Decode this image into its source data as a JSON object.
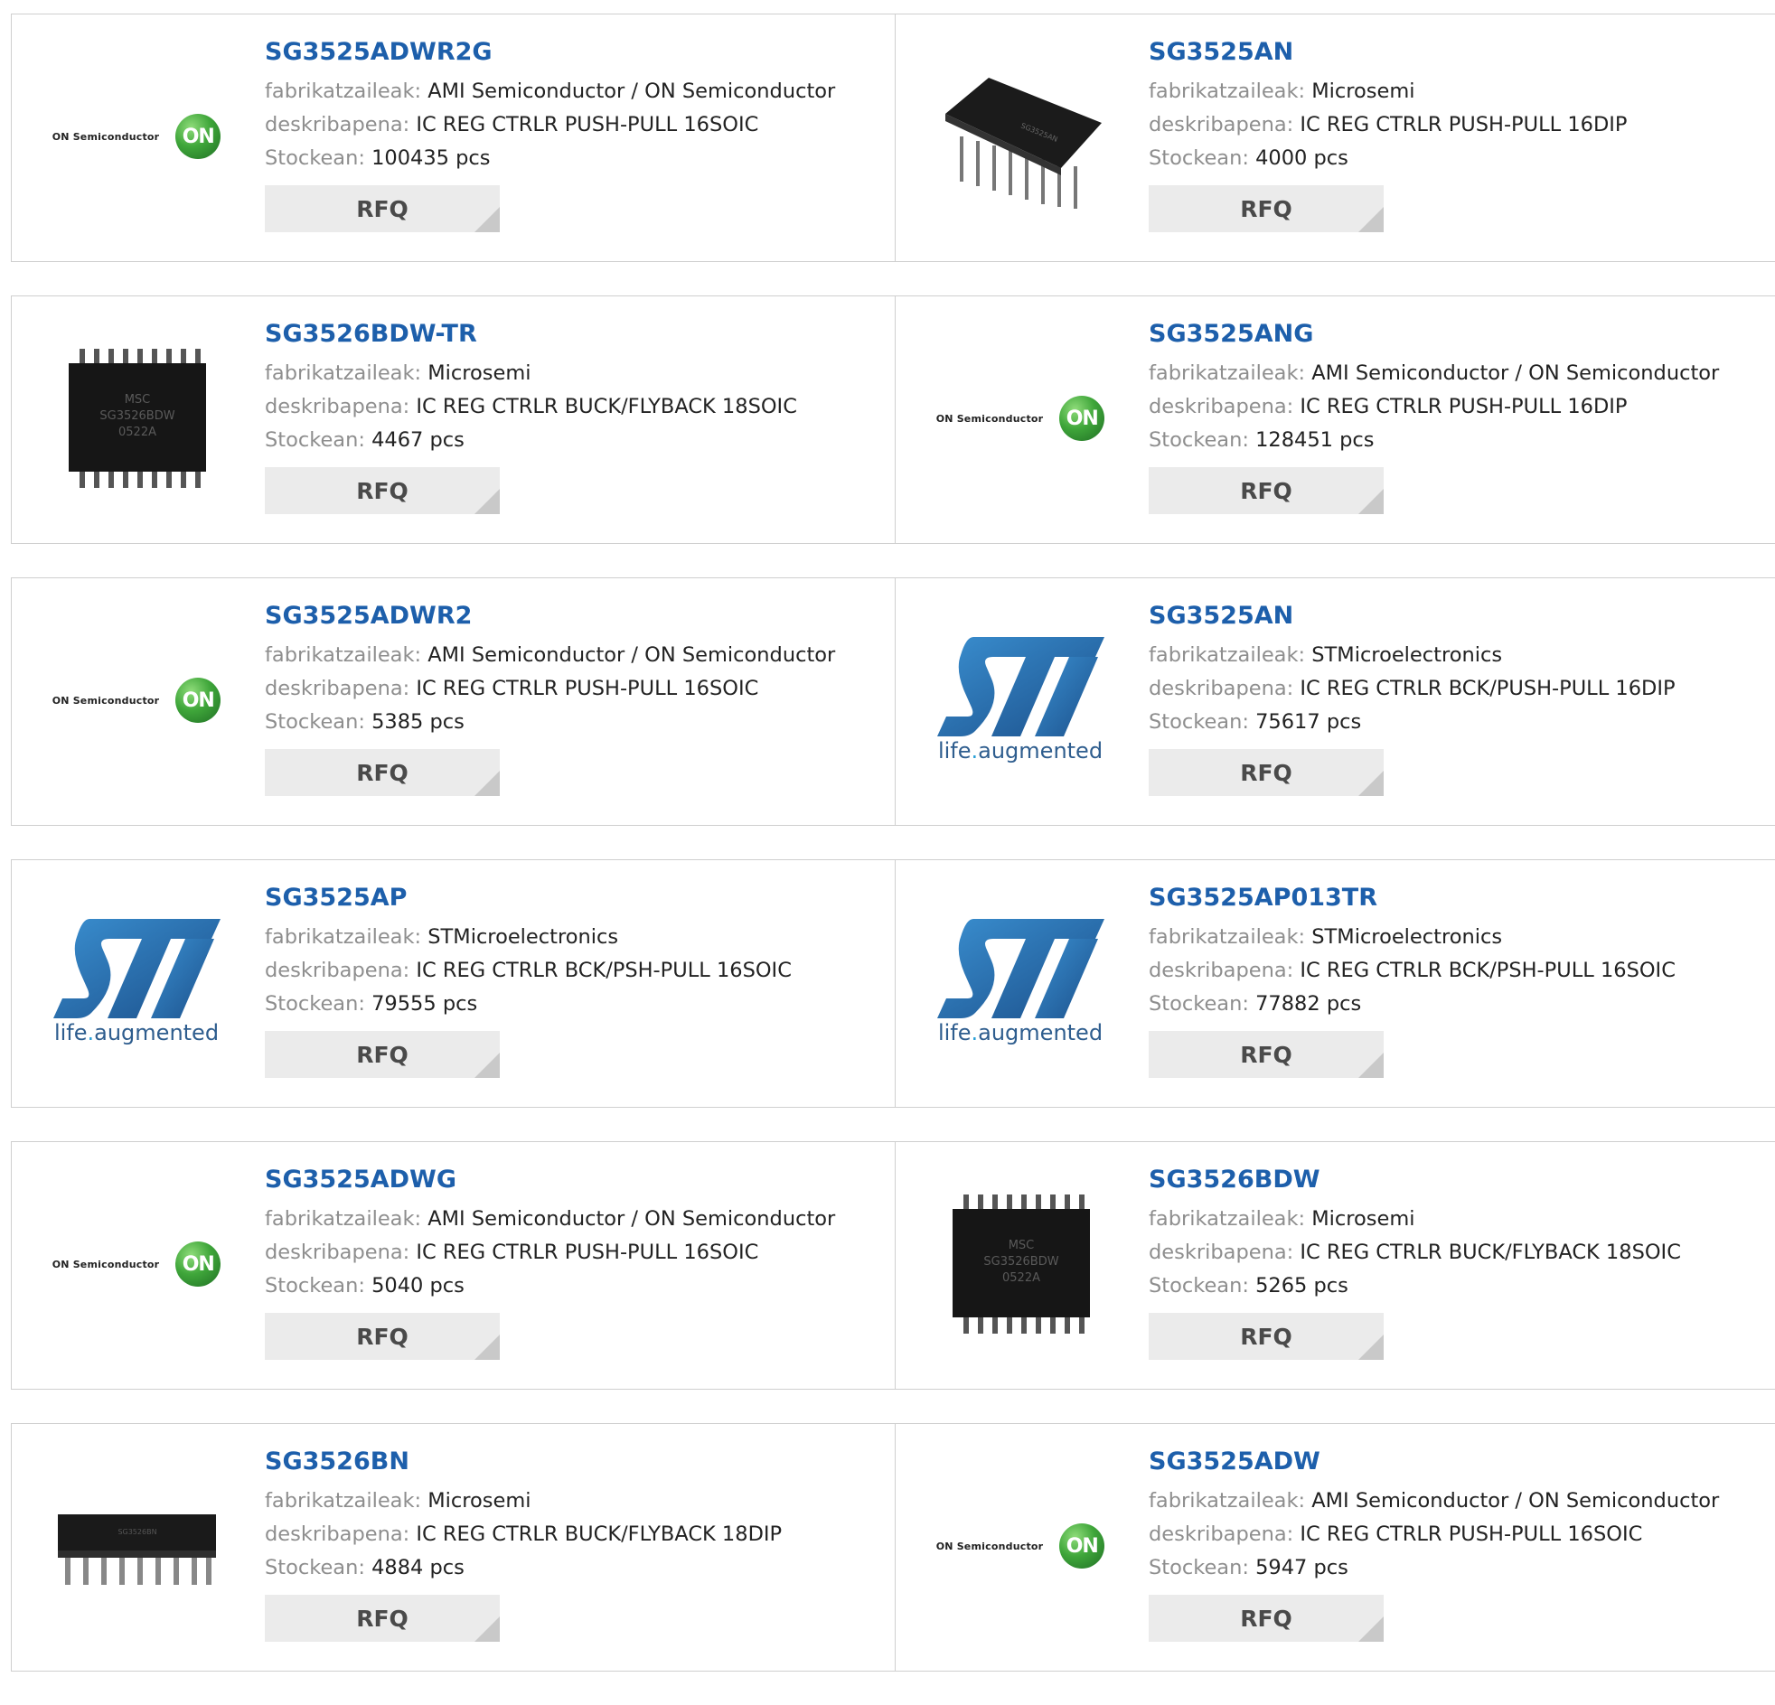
{
  "labels": {
    "manufacturer": "fabrikatzaileak:",
    "description": "deskribapena:",
    "stock": "Stockean:",
    "rfq": "RFQ"
  },
  "logos": {
    "on_text": "ON Semiconductor",
    "on_disc": "ON",
    "st_tag_a": "life",
    "st_tag_dot": ".",
    "st_tag_b": "augmented",
    "chip_msc": "MSC",
    "chip_3526": "SG3526BDW",
    "chip_code": "0522A"
  },
  "colors": {
    "part_link": "#1d5fab",
    "label_gray": "#8e8e8e",
    "button_bg": "#ebebeb",
    "on_green": "#3fa63a",
    "st_blue": "#2e6fb0"
  },
  "products": [
    {
      "part": "SG3525ADWR2G",
      "manufacturer": "AMI Semiconductor / ON Semiconductor",
      "description": "IC REG CTRLR PUSH-PULL 16SOIC",
      "stock": "100435 pcs",
      "image": "on-semiconductor-logo"
    },
    {
      "part": "SG3525AN",
      "manufacturer": "Microsemi",
      "description": "IC REG CTRLR PUSH-PULL 16DIP",
      "stock": "4000 pcs",
      "image": "dip16-chip"
    },
    {
      "part": "SG3526BDW-TR",
      "manufacturer": "Microsemi",
      "description": "IC REG CTRLR BUCK/FLYBACK 18SOIC",
      "stock": "4467 pcs",
      "image": "soic18-chip"
    },
    {
      "part": "SG3525ANG",
      "manufacturer": "AMI Semiconductor / ON Semiconductor",
      "description": "IC REG CTRLR PUSH-PULL 16DIP",
      "stock": "128451 pcs",
      "image": "on-semiconductor-logo"
    },
    {
      "part": "SG3525ADWR2",
      "manufacturer": "AMI Semiconductor / ON Semiconductor",
      "description": "IC REG CTRLR PUSH-PULL 16SOIC",
      "stock": "5385 pcs",
      "image": "on-semiconductor-logo"
    },
    {
      "part": "SG3525AN",
      "manufacturer": "STMicroelectronics",
      "description": "IC REG CTRLR BCK/PUSH-PULL 16DIP",
      "stock": "75617 pcs",
      "image": "st-logo"
    },
    {
      "part": "SG3525AP",
      "manufacturer": "STMicroelectronics",
      "description": "IC REG CTRLR BCK/PSH-PULL 16SOIC",
      "stock": "79555 pcs",
      "image": "st-logo"
    },
    {
      "part": "SG3525AP013TR",
      "manufacturer": "STMicroelectronics",
      "description": "IC REG CTRLR BCK/PSH-PULL 16SOIC",
      "stock": "77882 pcs",
      "image": "st-logo"
    },
    {
      "part": "SG3525ADWG",
      "manufacturer": "AMI Semiconductor / ON Semiconductor",
      "description": "IC REG CTRLR PUSH-PULL 16SOIC",
      "stock": "5040 pcs",
      "image": "on-semiconductor-logo"
    },
    {
      "part": "SG3526BDW",
      "manufacturer": "Microsemi",
      "description": "IC REG CTRLR BUCK/FLYBACK 18SOIC",
      "stock": "5265 pcs",
      "image": "soic18-chip"
    },
    {
      "part": "SG3526BN",
      "manufacturer": "Microsemi",
      "description": "IC REG CTRLR BUCK/FLYBACK 18DIP",
      "stock": "4884 pcs",
      "image": "dip18-chip"
    },
    {
      "part": "SG3525ADW",
      "manufacturer": "AMI Semiconductor / ON Semiconductor",
      "description": "IC REG CTRLR PUSH-PULL 16SOIC",
      "stock": "5947 pcs",
      "image": "on-semiconductor-logo"
    }
  ]
}
